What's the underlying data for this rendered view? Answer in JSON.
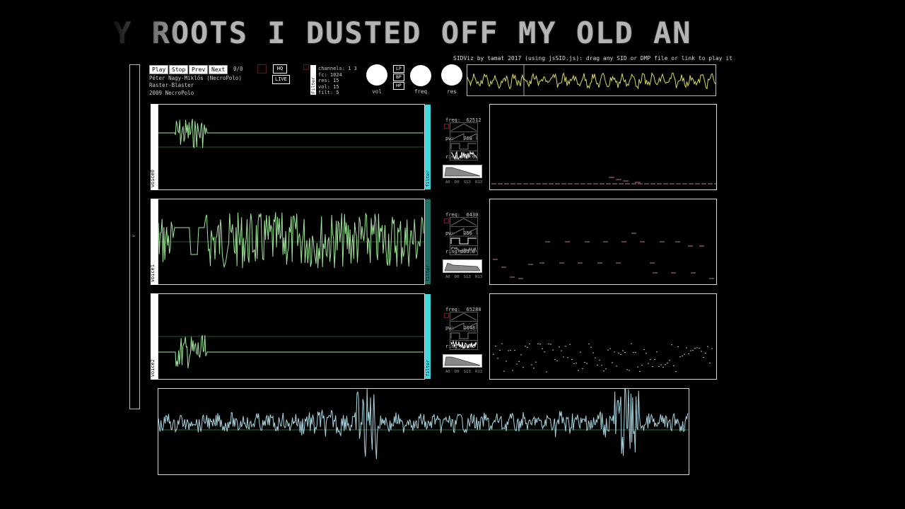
{
  "scroller": {
    "text": "Y ROOTS I DUSTED OFF MY OLD AN"
  },
  "header": {
    "info": "SIDViz by tamat 2017 (using jsSID.js): drag any SID or DMP file or link to play it"
  },
  "transport": {
    "play": "Play",
    "stop": "Stop",
    "prev": "Prev",
    "next": "Next",
    "counter": "0/0",
    "hq": "HQ",
    "live": "LIVE"
  },
  "song": {
    "author": "Péter Nagy-Miklós (NecroPolo)",
    "title": "Raster-Blaster",
    "released": "2009 NecroPolo"
  },
  "filter_panel": {
    "label": "Filter",
    "lines": [
      "channels: 1 3",
      "fc: 1024",
      "res: 15",
      "vol: 15",
      "filt: 5"
    ],
    "modes": [
      "LP",
      "BP",
      "HP"
    ]
  },
  "knobs": [
    {
      "label": "vol"
    },
    {
      "label": "freq"
    },
    {
      "label": "res"
    }
  ],
  "voices": [
    {
      "name": "voice0",
      "freq": "freq:  62512",
      "pw": "pw:   768",
      "ring": "ring_mod:0",
      "filter_label": "filter",
      "filter_color": "#3fd8dc"
    },
    {
      "name": "voice1",
      "freq": "freq:  6430",
      "pw": "pw:   256",
      "ring": "ring_mod:0",
      "filter_label": "filter",
      "filter_color": "#1f6e68"
    },
    {
      "name": "voice2",
      "freq": "freq:  65280",
      "pw": "pw:   2048",
      "ring": "ring_mod:0",
      "filter_label": "filter",
      "filter_color": "#3fd8dc"
    }
  ],
  "adsr_labels": "A0 D0 S13 R13",
  "colors": {
    "accent": "#3fd8dc",
    "voice_wave": "#9fe89a",
    "master_wave": "#a8d6e0",
    "mini_scope": "#d8d860",
    "pianoroll": "#c07a9a"
  }
}
